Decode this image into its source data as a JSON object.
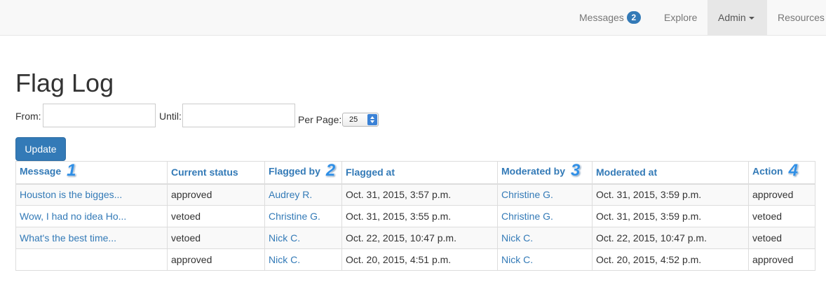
{
  "navbar": {
    "messages_label": "Messages",
    "messages_badge": "2",
    "explore_label": "Explore",
    "admin_label": "Admin",
    "resources_label": "Resources"
  },
  "page": {
    "title": "Flag Log"
  },
  "filters": {
    "from_label": "From:",
    "from_value": "",
    "until_label": "Until:",
    "until_value": "",
    "per_page_label": "Per Page:",
    "per_page_value": "25",
    "update_label": "Update"
  },
  "table": {
    "headers": {
      "message": "Message",
      "current_status": "Current status",
      "flagged_by": "Flagged by",
      "flagged_at": "Flagged at",
      "moderated_by": "Moderated by",
      "moderated_at": "Moderated at",
      "action": "Action"
    },
    "markers": [
      "1",
      "2",
      "3",
      "4"
    ],
    "rows": [
      {
        "message": "Houston is the bigges...",
        "current_status": "approved",
        "flagged_by": "Audrey R.",
        "flagged_at": "Oct. 31, 2015, 3:57 p.m.",
        "moderated_by": "Christine G.",
        "moderated_at": "Oct. 31, 2015, 3:59 p.m.",
        "action": "approved"
      },
      {
        "message": "Wow, I had no idea Ho...",
        "current_status": "vetoed",
        "flagged_by": "Christine G.",
        "flagged_at": "Oct. 31, 2015, 3:55 p.m.",
        "moderated_by": "Christine G.",
        "moderated_at": "Oct. 31, 2015, 3:59 p.m.",
        "action": "vetoed"
      },
      {
        "message": "What's the best time...",
        "current_status": "vetoed",
        "flagged_by": "Nick C.",
        "flagged_at": "Oct. 22, 2015, 10:47 p.m.",
        "moderated_by": "Nick C.",
        "moderated_at": "Oct. 22, 2015, 10:47 p.m.",
        "action": "vetoed"
      },
      {
        "message": "",
        "current_status": "approved",
        "flagged_by": "Nick C.",
        "flagged_at": "Oct. 20, 2015, 4:51 p.m.",
        "moderated_by": "Nick C.",
        "moderated_at": "Oct. 20, 2015, 4:52 p.m.",
        "action": "approved"
      }
    ]
  },
  "colors": {
    "link": "#337ab7",
    "primary_button": "#337ab7",
    "navbar_bg": "#f8f8f8",
    "active_nav_bg": "#e7e7e7",
    "marker": "#2f8fe6"
  }
}
